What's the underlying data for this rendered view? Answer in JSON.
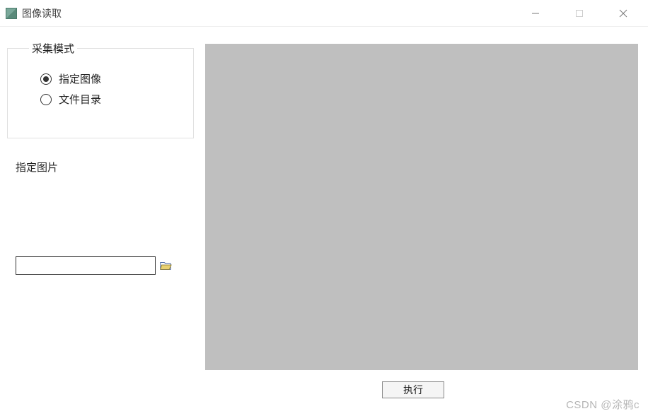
{
  "window": {
    "title": "图像读取"
  },
  "mode_box": {
    "legend": "采集模式",
    "options": {
      "specify_image": "指定图像",
      "file_dir": "文件目录"
    },
    "selected": "specify_image"
  },
  "section_label": "指定图片",
  "path_input": {
    "value": ""
  },
  "execute_button_label": "执行",
  "watermark": "CSDN @涂鸦c"
}
